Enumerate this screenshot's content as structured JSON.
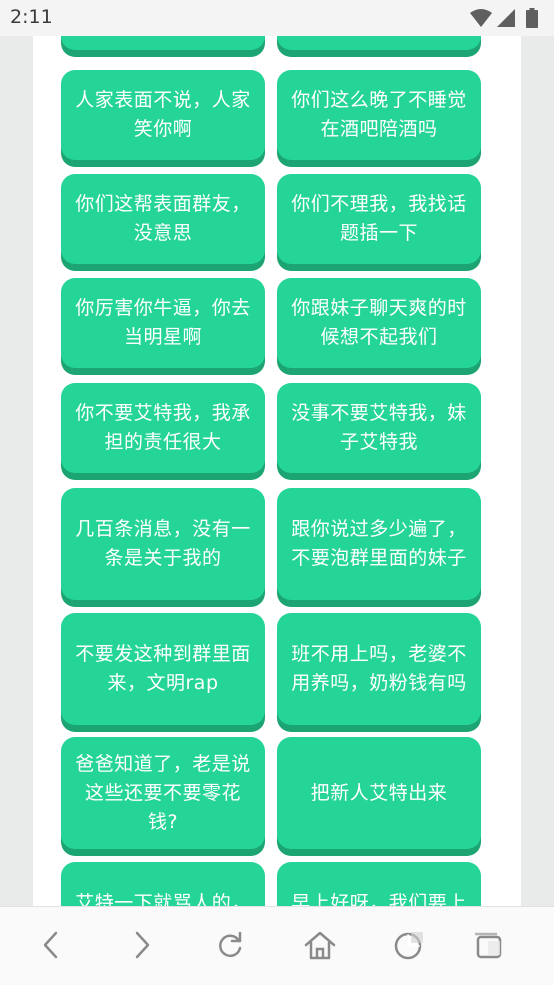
{
  "status_bar": {
    "time": "2:11",
    "icons": [
      "wifi-icon",
      "cellular-signal-icon",
      "battery-icon"
    ]
  },
  "cards": [
    "人家表面不说，人家笑你啊",
    "你们这么晚了不睡觉在酒吧陪酒吗",
    "你们这帮表面群友，没意思",
    "你们不理我，我找话题插一下",
    "你厉害你牛逼，你去当明星啊",
    "你跟妹子聊天爽的时候想不起我们",
    "你不要艾特我，我承担的责任很大",
    "没事不要艾特我，妹子艾特我",
    "几百条消息，没有一条是关于我的",
    "跟你说过多少遍了，不要泡群里面的妹子",
    "不要发这种到群里面来，文明rap",
    "班不用上吗，老婆不用养吗，奶粉钱有吗",
    "爸爸知道了，老是说这些还要不要零花钱?",
    "把新人艾特出来",
    "艾特一下就骂人的，不是亲戚关系",
    "早上好呀，我们要上班了"
  ],
  "nav_bar": {
    "icons": [
      "back-arrow-icon",
      "forward-arrow-icon",
      "refresh-icon",
      "home-icon",
      "menu-icon",
      "tabs-icon"
    ]
  },
  "colors": {
    "card_background": "#25d597",
    "card_shadow": "#1ca572",
    "card_text": "#ffffff",
    "page_background": "#e9ebea",
    "sheet_background": "#ffffff"
  }
}
